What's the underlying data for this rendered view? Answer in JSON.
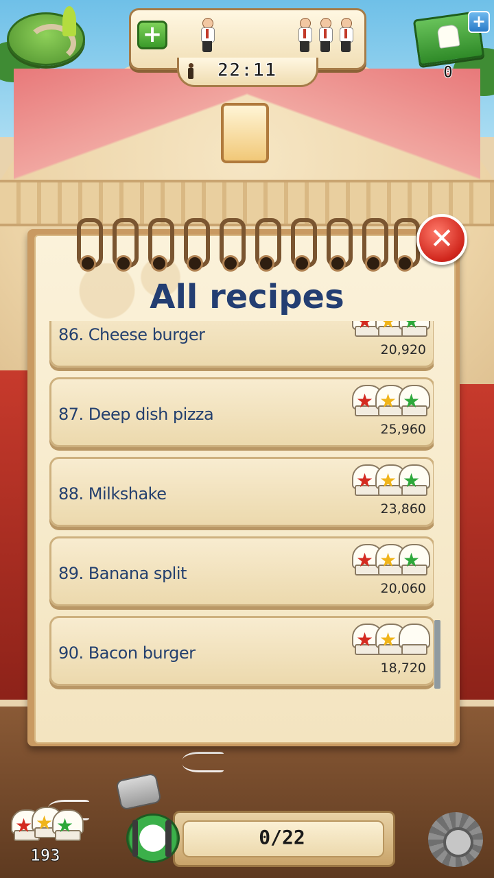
{
  "hud": {
    "add_staff_label": "+",
    "timer": "22:11",
    "cash_plus_label": "+",
    "cash_count": "0"
  },
  "notebook": {
    "title": "All recipes",
    "close_label": "✕",
    "recipes": [
      {
        "label": "86. Cheese burger",
        "score": "20,920",
        "stars": [
          "red",
          "gold",
          "green"
        ]
      },
      {
        "label": "87. Deep dish pizza",
        "score": "25,960",
        "stars": [
          "red",
          "gold",
          "green"
        ]
      },
      {
        "label": "88. Milkshake",
        "score": "23,860",
        "stars": [
          "red",
          "gold",
          "green"
        ]
      },
      {
        "label": "89. Banana split",
        "score": "20,060",
        "stars": [
          "red",
          "gold",
          "green"
        ]
      },
      {
        "label": "90. Bacon burger",
        "score": "18,720",
        "stars": [
          "red",
          "gold",
          "none"
        ]
      }
    ]
  },
  "footer": {
    "total_stars": "193",
    "progress": "0/22"
  },
  "colors": {
    "title": "#233e72",
    "star_red": "#d42a20",
    "star_gold": "#f0b419",
    "star_green": "#2da83a"
  },
  "icons": {
    "map": "map-icon",
    "add_staff": "plus-icon",
    "cash": "cash-icon",
    "close": "close-icon",
    "stars": "chef-hat-stars-icon",
    "meal": "plate-utensils-icon",
    "settings": "gear-icon"
  }
}
